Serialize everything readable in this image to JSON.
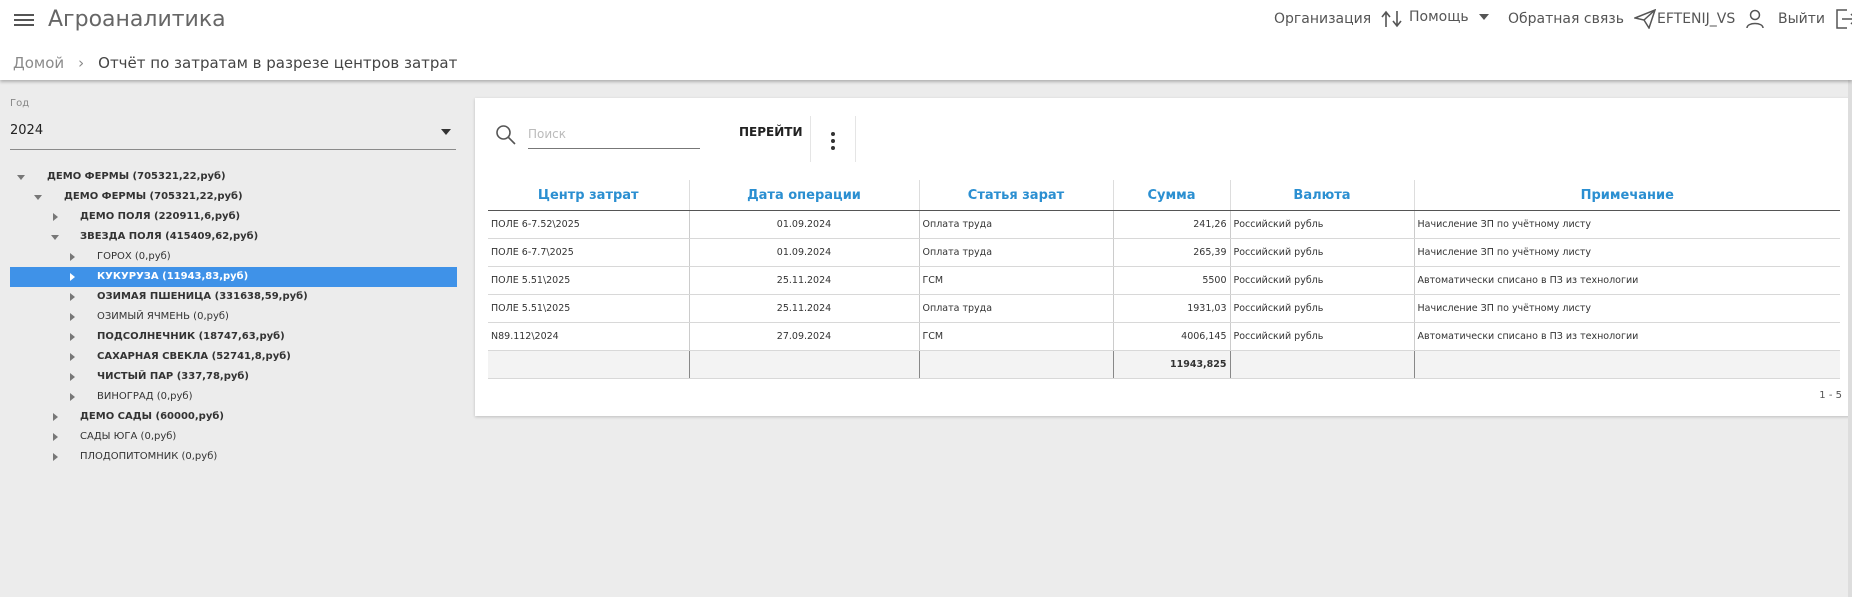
{
  "header": {
    "app_title": "Агроаналитика",
    "organization_label": "Организация",
    "help_label": "Помощь",
    "feedback_label": "Обратная связь",
    "user_label": "EFTENIJ_VS",
    "logout_label": "Выйти"
  },
  "breadcrumb": {
    "home": "Домой",
    "current": "Отчёт по затратам в разрезе центров затрат"
  },
  "filter": {
    "year_label": "Год",
    "year_value": "2024"
  },
  "tree": [
    {
      "label": "ДЕМО ФЕРМЫ (705321,22,руб)",
      "level": 0,
      "toggle": "down",
      "bold": true
    },
    {
      "label": "ДЕМО ФЕРМЫ (705321,22,руб)",
      "level": 1,
      "toggle": "down",
      "bold": true
    },
    {
      "label": "ДЕМО ПОЛЯ (220911,6,руб)",
      "level": 2,
      "toggle": "right",
      "bold": true
    },
    {
      "label": "ЗВЕЗДА ПОЛЯ (415409,62,руб)",
      "level": 2,
      "toggle": "down",
      "bold": true
    },
    {
      "label": "ГОРОХ (0,руб)",
      "level": 3,
      "toggle": "right",
      "bold": false
    },
    {
      "label": "КУКУРУЗА (11943,83,руб)",
      "level": 3,
      "toggle": "right",
      "bold": true,
      "selected": true
    },
    {
      "label": "ОЗИМАЯ ПШЕНИЦА (331638,59,руб)",
      "level": 3,
      "toggle": "right",
      "bold": true
    },
    {
      "label": "ОЗИМЫЙ ЯЧМЕНЬ (0,руб)",
      "level": 3,
      "toggle": "right",
      "bold": false
    },
    {
      "label": "ПОДСОЛНЕЧНИК (18747,63,руб)",
      "level": 3,
      "toggle": "right",
      "bold": true
    },
    {
      "label": "САХАРНАЯ СВЕКЛА (52741,8,руб)",
      "level": 3,
      "toggle": "right",
      "bold": true
    },
    {
      "label": "ЧИСТЫЙ ПАР (337,78,руб)",
      "level": 3,
      "toggle": "right",
      "bold": true
    },
    {
      "label": "ВИНОГРАД (0,руб)",
      "level": 3,
      "toggle": "right",
      "bold": false
    },
    {
      "label": "ДЕМО САДЫ (60000,руб)",
      "level": 2,
      "toggle": "right",
      "bold": true
    },
    {
      "label": "САДЫ ЮГА (0,руб)",
      "level": 2,
      "toggle": "right",
      "bold": false
    },
    {
      "label": "ПЛОДОПИТОМНИК (0,руб)",
      "level": 2,
      "toggle": "right",
      "bold": false
    }
  ],
  "search": {
    "placeholder": "Поиск",
    "value": "",
    "go_label": "ПЕРЕЙТИ"
  },
  "table": {
    "columns": [
      "Центр затрат",
      "Дата операции",
      "Статья зарат",
      "Сумма",
      "Валюта",
      "Примечание"
    ],
    "rows": [
      [
        "ПОЛЕ 6-7.52\\2025",
        "01.09.2024",
        "Оплата труда",
        "241,26",
        "Российский рубль",
        "Начисление ЗП по учётному листу"
      ],
      [
        "ПОЛЕ 6-7.7\\2025",
        "01.09.2024",
        "Оплата труда",
        "265,39",
        "Российский рубль",
        "Начисление ЗП по учётному листу"
      ],
      [
        "ПОЛЕ 5.51\\2025",
        "25.11.2024",
        "ГСМ",
        "5500",
        "Российский рубль",
        "Автоматически списано в ПЗ из технологии"
      ],
      [
        "ПОЛЕ 5.51\\2025",
        "25.11.2024",
        "Оплата труда",
        "1931,03",
        "Российский рубль",
        "Начисление ЗП по учётному листу"
      ],
      [
        "N89.112\\2024",
        "27.09.2024",
        "ГСМ",
        "4006,145",
        "Российский рубль",
        "Автоматически списано в ПЗ из технологии"
      ]
    ],
    "total": "11943,825"
  },
  "pager": "1 - 5"
}
